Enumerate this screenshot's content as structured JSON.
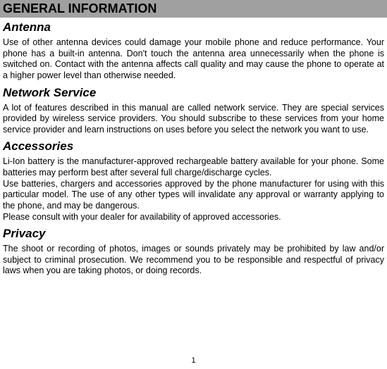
{
  "header": "GENERAL INFORMATION",
  "sections": {
    "antenna": {
      "title": "Antenna",
      "body": "Use of other antenna devices could damage your mobile phone and reduce performance. Your phone has a built-in antenna. Don't touch the antenna area unnecessarily when the phone is switched on. Contact with the antenna affects call quality and may cause the phone to operate at a higher power level than otherwise needed."
    },
    "network": {
      "title": "Network Service",
      "body": "A lot of features described in this manual are called network service. They are special services provided by wireless service providers. You should subscribe to these services from your home service provider and learn instructions on uses before you select the network you want to use."
    },
    "accessories": {
      "title": "Accessories",
      "body": "Li-Ion battery is the manufacturer-approved rechargeable battery available for your phone. Some batteries may perform best after several full charge/discharge cycles.\nUse batteries, chargers and accessories approved by the phone manufacturer for using with this particular model. The use of any other types will invalidate any approval or warranty applying to the phone, and may be dangerous.\nPlease consult with your dealer for availability of approved accessories."
    },
    "privacy": {
      "title": "Privacy",
      "body": "The shoot or recording of photos, images or sounds privately may be prohibited by law and/or subject to criminal prosecution. We recommend you to be responsible and respectful of privacy laws when you are taking photos, or doing records."
    }
  },
  "page_number": "1"
}
